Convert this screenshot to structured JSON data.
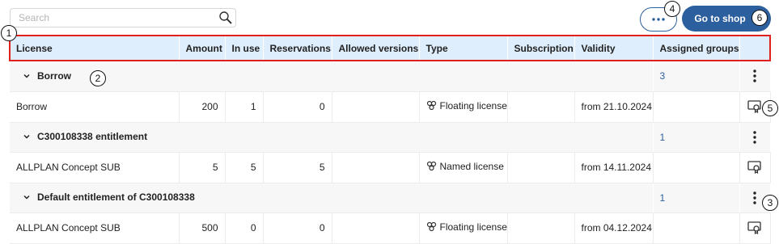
{
  "search": {
    "placeholder": "Search",
    "value": ""
  },
  "toolbar": {
    "more_label": "···",
    "shop_label": "Go to shop"
  },
  "table": {
    "columns": [
      "License",
      "Amount",
      "In use",
      "Reservations",
      "Allowed versions",
      "Type",
      "Subscription",
      "Validity",
      "Assigned groups"
    ],
    "groups": [
      {
        "name": "Borrow",
        "assigned_groups": "3",
        "rows": [
          {
            "license": "Borrow",
            "amount": "200",
            "in_use": "1",
            "reservations": "0",
            "allowed_versions": "",
            "type": "Floating license",
            "subscription": "",
            "validity": "from 21.10.2024"
          }
        ]
      },
      {
        "name": "C300108338 entitlement",
        "assigned_groups": "1",
        "rows": [
          {
            "license": "ALLPLAN Concept SUB",
            "amount": "5",
            "in_use": "5",
            "reservations": "5",
            "allowed_versions": "",
            "type": "Named license",
            "subscription": "",
            "validity": "from 14.11.2024"
          }
        ]
      },
      {
        "name": "Default entitlement of C300108338",
        "assigned_groups": "1",
        "rows": [
          {
            "license": "ALLPLAN Concept SUB",
            "amount": "500",
            "in_use": "0",
            "reservations": "0",
            "allowed_versions": "",
            "type": "Floating license",
            "subscription": "",
            "validity": "from 04.12.2024"
          }
        ]
      }
    ]
  },
  "callouts": {
    "c1": "1",
    "c2": "2",
    "c3": "3",
    "c4": "4",
    "c5": "5",
    "c6": "6"
  },
  "colors": {
    "accent": "#2c5f9e",
    "header_bg": "#dfeefc",
    "highlight": "#e0201f"
  },
  "icons": {
    "search": "magnifier-icon",
    "more": "ellipsis-icon",
    "expand": "chevron-down-icon",
    "row_menu": "kebab-icon",
    "type": "license-group-icon",
    "certificate": "certificate-icon"
  }
}
